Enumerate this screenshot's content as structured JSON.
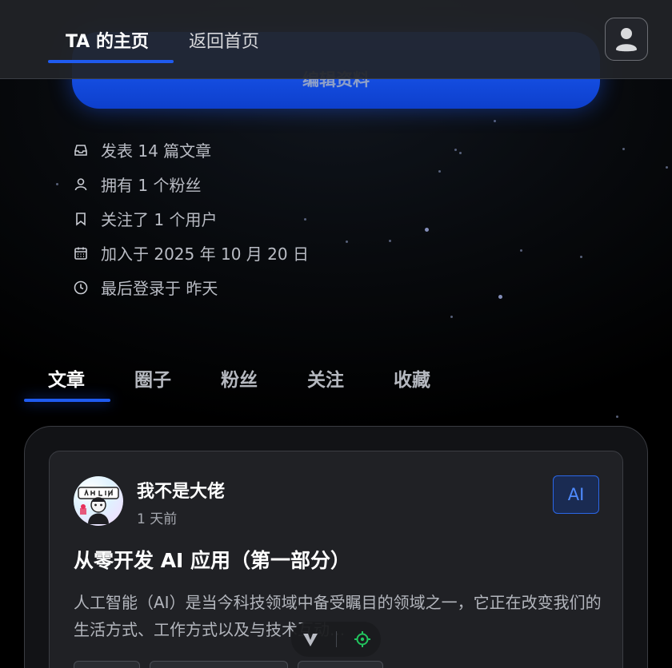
{
  "nav": {
    "profile_tab": "TA 的主页",
    "back_home": "返回首页"
  },
  "profile": {
    "edit_button": "编辑资料"
  },
  "stats": {
    "posts": "发表 14 篇文章",
    "followers": "拥有 1 个粉丝",
    "following": "关注了 1 个用户",
    "joined": "加入于 2025 年 10 月 20 日",
    "last_login": "最后登录于 昨天"
  },
  "tabs": [
    {
      "label": "文章",
      "active": true
    },
    {
      "label": "圈子",
      "active": false
    },
    {
      "label": "粉丝",
      "active": false
    },
    {
      "label": "关注",
      "active": false
    },
    {
      "label": "收藏",
      "active": false
    }
  ],
  "post": {
    "author": "我不是大佬",
    "time": "1 天前",
    "tag": "AI",
    "title": "从零开发 AI 应用（第一部分）",
    "excerpt": "人工智能（AI）是当今科技领域中备受瞩目的领域之一，它正在改变我们的生活方式、工作方式以及与技术互动..."
  },
  "colors": {
    "accent": "#1f5bf0",
    "background": "#000000",
    "card": "#202125",
    "locate_icon": "#22c55e"
  },
  "icons": {
    "avatar": "user-icon",
    "posts": "inbox-icon",
    "followers": "user-icon",
    "following": "bookmark-icon",
    "joined": "calendar-icon",
    "last_login": "clock-icon",
    "float_down": "chevron-down-icon",
    "float_locate": "crosshair-icon"
  }
}
